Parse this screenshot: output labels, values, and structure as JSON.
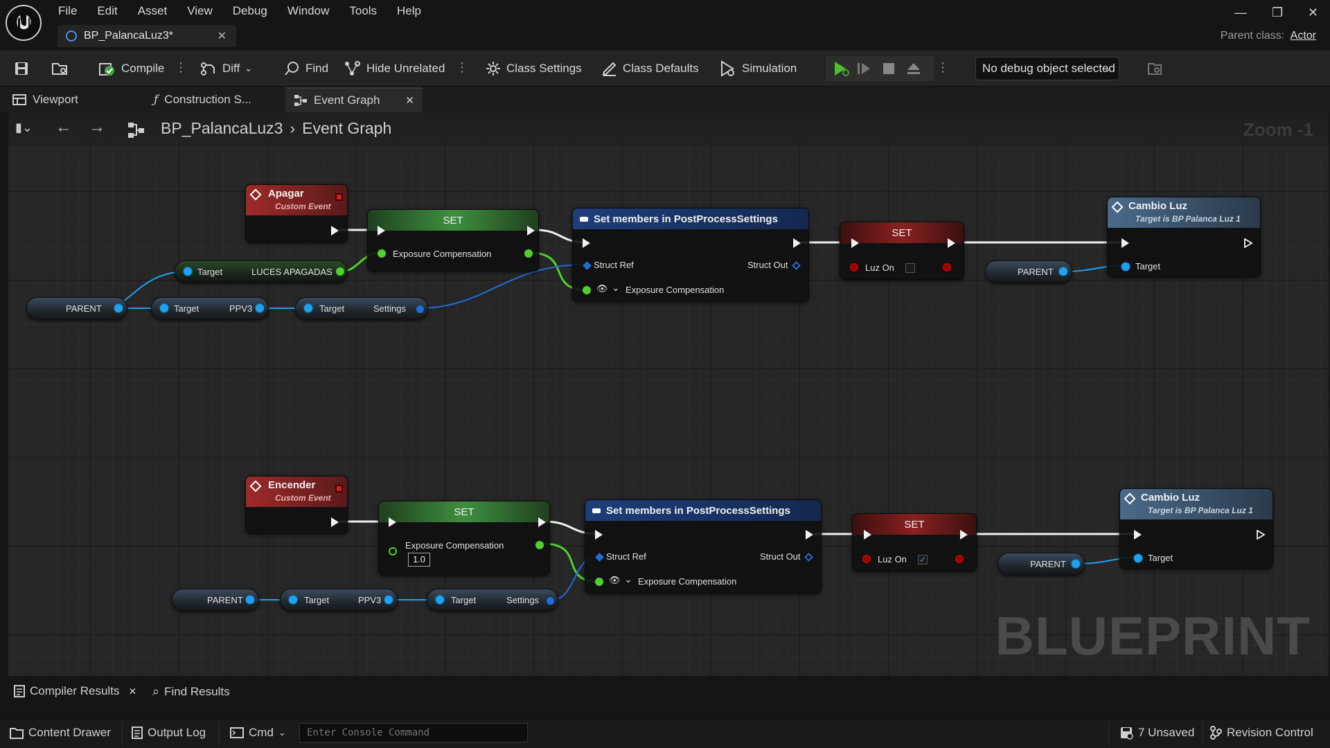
{
  "menu": [
    "File",
    "Edit",
    "Asset",
    "View",
    "Debug",
    "Window",
    "Tools",
    "Help"
  ],
  "doc_tab": "BP_PalancaLuz3*",
  "parent_class": {
    "label": "Parent class:",
    "value": "Actor"
  },
  "toolbar": {
    "compile": "Compile",
    "diff": "Diff",
    "find": "Find",
    "hide_unrelated": "Hide Unrelated",
    "class_settings": "Class Settings",
    "class_defaults": "Class Defaults",
    "simulation": "Simulation",
    "debug_object": "No debug object selected"
  },
  "editor_tabs": {
    "viewport": "Viewport",
    "construction": "Construction S...",
    "event_graph": "Event Graph"
  },
  "breadcrumb": {
    "blueprint": "BP_PalancaLuz3",
    "graph": "Event Graph"
  },
  "zoom": "Zoom -1",
  "watermark": "BLUEPRINT",
  "nodes": {
    "row1": {
      "event_title": "Apagar",
      "event_sub": "Custom Event",
      "set1_title": "SET",
      "set1_pin": "Exposure Compensation",
      "struct_title": "Set members in PostProcessSettings",
      "struct_ref": "Struct Ref",
      "struct_out": "Struct Out",
      "struct_expo": "Exposure Compensation",
      "set2_title": "SET",
      "set2_pin": "Luz On",
      "call_title": "Cambio Luz",
      "call_sub": "Target is BP Palanca Luz 1",
      "call_target": "Target",
      "parent_right": "PARENT",
      "luces_target": "Target",
      "luces_label": "LUCES APAGADAS",
      "parent_left": "PARENT",
      "ppv_target": "Target",
      "ppv_label": "PPV3",
      "settings_target": "Target",
      "settings_label": "Settings"
    },
    "row2": {
      "event_title": "Encender",
      "event_sub": "Custom Event",
      "set1_title": "SET",
      "set1_pin": "Exposure Compensation",
      "set1_value": "1.0",
      "struct_title": "Set members in PostProcessSettings",
      "struct_ref": "Struct Ref",
      "struct_out": "Struct Out",
      "struct_expo": "Exposure Compensation",
      "set2_title": "SET",
      "set2_pin": "Luz On",
      "call_title": "Cambio Luz",
      "call_sub": "Target is BP Palanca Luz 1",
      "call_target": "Target",
      "parent_right": "PARENT",
      "parent_left": "PARENT",
      "ppv_target": "Target",
      "ppv_label": "PPV3",
      "settings_target": "Target",
      "settings_label": "Settings"
    }
  },
  "bottom_tabs": {
    "compiler_results": "Compiler Results",
    "find_results": "Find Results"
  },
  "statusbar": {
    "content_drawer": "Content Drawer",
    "output_log": "Output Log",
    "cmd": "Cmd",
    "console_placeholder": "Enter Console Command",
    "unsaved": "7 Unsaved",
    "revision_control": "Revision Control"
  },
  "colors": {
    "exec_pin": "#f2f2f2",
    "object_pin": "#1da1f2",
    "float_pin": "#4ed12d",
    "bool_pin": "#8a0000",
    "struct_pin": "#1c6ed8"
  }
}
